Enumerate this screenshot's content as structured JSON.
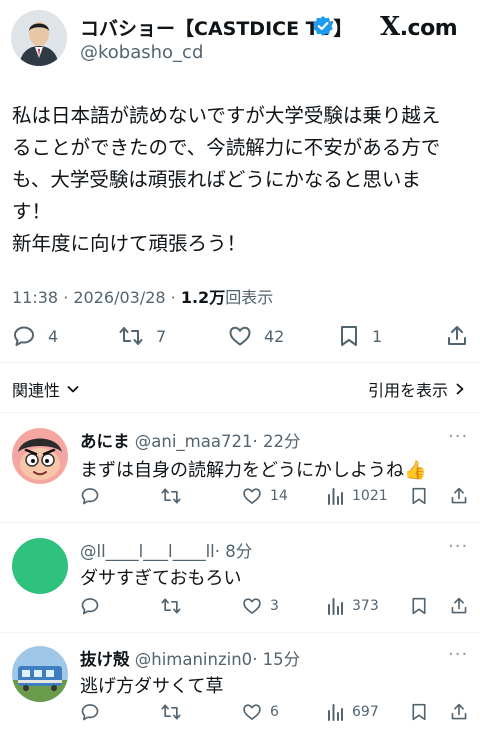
{
  "header": {
    "author_name": "コバショー【CASTDICE TV】",
    "author_handle": "@kobasho_cd",
    "brand": ".com",
    "brand_x": "X"
  },
  "tweet": {
    "lines": [
      "私は日本語が読めないですが大学受験は乗り越え",
      "ることができたので、今読解力に不安がある方で",
      "も、大学受験は頑張ればどうにかなると思いま",
      "す！",
      "新年度に向けて頑張ろう！"
    ],
    "time": "11:38 · 2026/03/28 · ",
    "views_count": "1.2万",
    "views_label": "回表示",
    "reply_count": "4",
    "retweet_count": "7",
    "like_count": "42",
    "bookmark_count": "1"
  },
  "related_label": "関連性",
  "quotes_label": "引用を表示",
  "replies": [
    {
      "name": "あにま",
      "handle": "@ani_maa721",
      "time": "· 22分",
      "text": "まずは自身の読解力をどうにかしようね",
      "emoji": "👍",
      "reply_count": "",
      "retweet_count": "",
      "like_count": "14",
      "view_count": "1021"
    },
    {
      "name": "",
      "handle": "@ll____l___l____ll",
      "time": "· 8分",
      "text": "ダサすぎておもろい",
      "reply_count": "",
      "retweet_count": "",
      "like_count": "3",
      "view_count": "373"
    },
    {
      "name": "抜け殻",
      "handle": "@himaninzin0",
      "time": "· 15分",
      "text": "逃げ方ダサくて草",
      "reply_count": "",
      "retweet_count": "",
      "like_count": "6",
      "view_count": "697"
    }
  ],
  "colors": {
    "text": "#0f1419",
    "muted": "#536471",
    "verified": "#1d9bf0",
    "divider": "#eff3f4",
    "reply2_avatar": "#2ec27e"
  },
  "icons": [
    "verified-badge-icon",
    "reply-icon",
    "retweet-icon",
    "like-icon",
    "bookmark-icon",
    "share-icon",
    "views-icon",
    "more-icon",
    "chevron-down-icon",
    "chevron-right-icon"
  ]
}
